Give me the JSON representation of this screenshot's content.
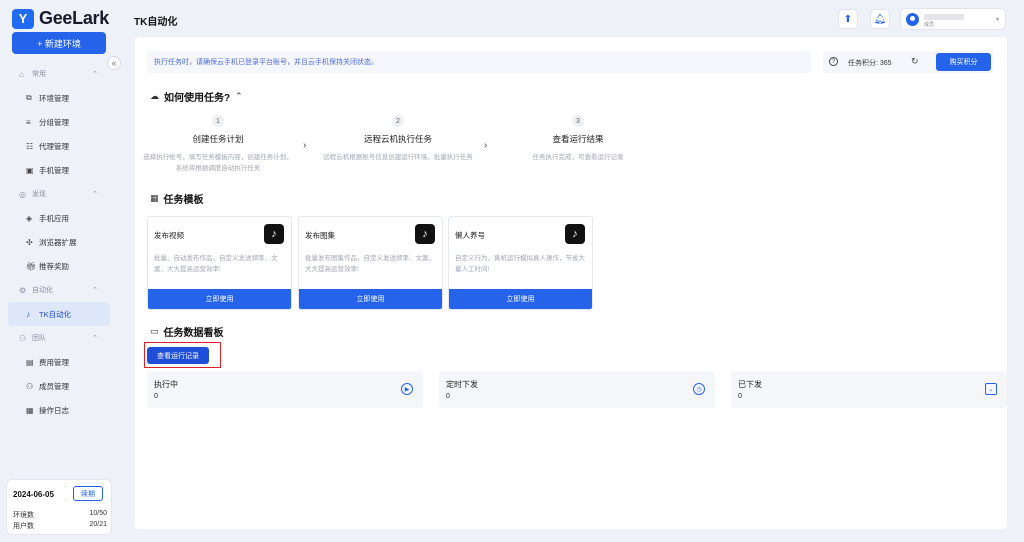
{
  "app": {
    "name": "GeeLark",
    "page_title": "TK自动化"
  },
  "sidebar": {
    "new_env_label": "+ 新建环境",
    "collapse_icon": "«",
    "groups": [
      {
        "label": "常用",
        "items": [
          "环境管理",
          "分组管理",
          "代理管理",
          "手机管理"
        ]
      },
      {
        "label": "发现",
        "items": [
          "手机应用",
          "浏览器扩展",
          "推荐奖励"
        ]
      },
      {
        "label": "自动化",
        "items": [
          "TK自动化"
        ]
      },
      {
        "label": "团队",
        "items": [
          "费用管理",
          "成员管理",
          "操作日志"
        ]
      }
    ],
    "active_item": "TK自动化",
    "plan": {
      "date": "2024-06-05",
      "renew_label": "续期",
      "env_label": "环境数",
      "env_value": "10/50",
      "user_label": "用户数",
      "user_value": "20/21"
    }
  },
  "topbar": {
    "user_role": "成员"
  },
  "notice": {
    "text": "执行任务时，请确保云手机已登录平台账号，并且云手机保持关闭状态。"
  },
  "points": {
    "label": "任务积分: 365",
    "buy_label": "购买积分"
  },
  "how_to": {
    "title": "如何使用任务?",
    "steps": [
      {
        "num": "1",
        "title": "创建任务计划",
        "desc": "选择执行帐号，填写任务模板内容，创建任务计划，系统将根据调度自动执行任务"
      },
      {
        "num": "2",
        "title": "远程云机执行任务",
        "desc": "远程云机根据账号信息创建运行环境，批量执行任务"
      },
      {
        "num": "3",
        "title": "查看运行结果",
        "desc": "任务执行完成，可查看运行记录"
      }
    ]
  },
  "templates": {
    "title": "任务模板",
    "use_label": "立即使用",
    "items": [
      {
        "name": "发布视频",
        "desc": "批量、自动发布作品，自定义发送频率、文案，大大提高运营效率!"
      },
      {
        "name": "发布图集",
        "desc": "批量发布图集作品，自定义发送频率、文案，大大提高运营效率!"
      },
      {
        "name": "懒人养号",
        "desc": "自定义行为，真机运行模拟真人操作，节省大量人工时间!"
      }
    ]
  },
  "dashboard": {
    "title": "任务数据看板",
    "records_label": "查看运行记录",
    "stats": [
      {
        "label": "执行中",
        "value": "0",
        "icon": "play-icon"
      },
      {
        "label": "定时下发",
        "value": "0",
        "icon": "clock-icon"
      },
      {
        "label": "已下发",
        "value": "0",
        "icon": "download-icon"
      }
    ]
  },
  "colors": {
    "primary": "#2563eb",
    "highlight": "#e02020",
    "sidebar_bg": "#eef1f8"
  }
}
